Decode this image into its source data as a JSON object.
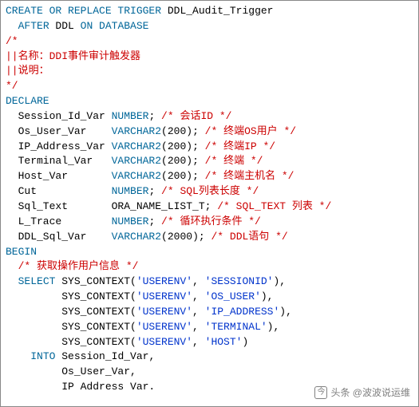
{
  "lines": [
    [
      {
        "c": "kw",
        "t": "CREATE OR REPLACE TRIGGER"
      },
      {
        "c": "ident",
        "t": " DDL_Audit_Trigger"
      }
    ],
    [
      {
        "c": "ident",
        "t": "  "
      },
      {
        "c": "kw",
        "t": "AFTER"
      },
      {
        "c": "ident",
        "t": " DDL "
      },
      {
        "c": "kw",
        "t": "ON DATABASE"
      }
    ],
    [
      {
        "c": "cm",
        "t": "/*"
      }
    ],
    [
      {
        "c": "cm",
        "t": "||名称：DDI事件审计触发器"
      }
    ],
    [
      {
        "c": "cm",
        "t": "||说明："
      }
    ],
    [
      {
        "c": "cm",
        "t": "*/"
      }
    ],
    [
      {
        "c": "kw",
        "t": "DECLARE"
      }
    ],
    [
      {
        "c": "ident",
        "t": ""
      }
    ],
    [
      {
        "c": "ident",
        "t": "  Session_Id_Var "
      },
      {
        "c": "kw",
        "t": "NUMBER"
      },
      {
        "c": "ident",
        "t": "; "
      },
      {
        "c": "cm",
        "t": "/* 会话ID */"
      }
    ],
    [
      {
        "c": "ident",
        "t": "  Os_User_Var    "
      },
      {
        "c": "kw",
        "t": "VARCHAR2"
      },
      {
        "c": "ident",
        "t": "("
      },
      {
        "c": "num",
        "t": "200"
      },
      {
        "c": "ident",
        "t": "); "
      },
      {
        "c": "cm",
        "t": "/* 终端OS用户 */"
      }
    ],
    [
      {
        "c": "ident",
        "t": "  IP_Address_Var "
      },
      {
        "c": "kw",
        "t": "VARCHAR2"
      },
      {
        "c": "ident",
        "t": "("
      },
      {
        "c": "num",
        "t": "200"
      },
      {
        "c": "ident",
        "t": "); "
      },
      {
        "c": "cm",
        "t": "/* 终端IP */"
      }
    ],
    [
      {
        "c": "ident",
        "t": "  Terminal_Var   "
      },
      {
        "c": "kw",
        "t": "VARCHAR2"
      },
      {
        "c": "ident",
        "t": "("
      },
      {
        "c": "num",
        "t": "200"
      },
      {
        "c": "ident",
        "t": "); "
      },
      {
        "c": "cm",
        "t": "/* 终端 */"
      }
    ],
    [
      {
        "c": "ident",
        "t": "  Host_Var       "
      },
      {
        "c": "kw",
        "t": "VARCHAR2"
      },
      {
        "c": "ident",
        "t": "("
      },
      {
        "c": "num",
        "t": "200"
      },
      {
        "c": "ident",
        "t": "); "
      },
      {
        "c": "cm",
        "t": "/* 终端主机名 */"
      }
    ],
    [
      {
        "c": "ident",
        "t": "  Cut            "
      },
      {
        "c": "kw",
        "t": "NUMBER"
      },
      {
        "c": "ident",
        "t": "; "
      },
      {
        "c": "cm",
        "t": "/* SQL列表长度 */"
      }
    ],
    [
      {
        "c": "ident",
        "t": "  Sql_Text       ORA_NAME_LIST_T; "
      },
      {
        "c": "cm",
        "t": "/* SQL_TEXT 列表 */"
      }
    ],
    [
      {
        "c": "ident",
        "t": "  L_Trace        "
      },
      {
        "c": "kw",
        "t": "NUMBER"
      },
      {
        "c": "ident",
        "t": "; "
      },
      {
        "c": "cm",
        "t": "/* 循环执行条件 */"
      }
    ],
    [
      {
        "c": "ident",
        "t": "  DDL_Sql_Var    "
      },
      {
        "c": "kw",
        "t": "VARCHAR2"
      },
      {
        "c": "ident",
        "t": "("
      },
      {
        "c": "num",
        "t": "2000"
      },
      {
        "c": "ident",
        "t": "); "
      },
      {
        "c": "cm",
        "t": "/* DDL语句 */"
      }
    ],
    [
      {
        "c": "ident",
        "t": ""
      }
    ],
    [
      {
        "c": "kw",
        "t": "BEGIN"
      }
    ],
    [
      {
        "c": "ident",
        "t": ""
      }
    ],
    [
      {
        "c": "ident",
        "t": "  "
      },
      {
        "c": "cm",
        "t": "/* 获取操作用户信息 */"
      }
    ],
    [
      {
        "c": "ident",
        "t": "  "
      },
      {
        "c": "kw",
        "t": "SELECT"
      },
      {
        "c": "ident",
        "t": " SYS_CONTEXT("
      },
      {
        "c": "str",
        "t": "'USERENV'"
      },
      {
        "c": "ident",
        "t": ", "
      },
      {
        "c": "str",
        "t": "'SESSIONID'"
      },
      {
        "c": "ident",
        "t": "),"
      }
    ],
    [
      {
        "c": "ident",
        "t": "         SYS_CONTEXT("
      },
      {
        "c": "str",
        "t": "'USERENV'"
      },
      {
        "c": "ident",
        "t": ", "
      },
      {
        "c": "str",
        "t": "'OS_USER'"
      },
      {
        "c": "ident",
        "t": "),"
      }
    ],
    [
      {
        "c": "ident",
        "t": "         SYS_CONTEXT("
      },
      {
        "c": "str",
        "t": "'USERENV'"
      },
      {
        "c": "ident",
        "t": ", "
      },
      {
        "c": "str",
        "t": "'IP_ADDRESS'"
      },
      {
        "c": "ident",
        "t": "),"
      }
    ],
    [
      {
        "c": "ident",
        "t": "         SYS_CONTEXT("
      },
      {
        "c": "str",
        "t": "'USERENV'"
      },
      {
        "c": "ident",
        "t": ", "
      },
      {
        "c": "str",
        "t": "'TERMINAL'"
      },
      {
        "c": "ident",
        "t": "),"
      }
    ],
    [
      {
        "c": "ident",
        "t": "         SYS_CONTEXT("
      },
      {
        "c": "str",
        "t": "'USERENV'"
      },
      {
        "c": "ident",
        "t": ", "
      },
      {
        "c": "str",
        "t": "'HOST'"
      },
      {
        "c": "ident",
        "t": ")"
      }
    ],
    [
      {
        "c": "ident",
        "t": "    "
      },
      {
        "c": "kw",
        "t": "INTO"
      },
      {
        "c": "ident",
        "t": " Session_Id_Var,"
      }
    ],
    [
      {
        "c": "ident",
        "t": "         Os_User_Var,"
      }
    ],
    [
      {
        "c": "ident",
        "t": "         IP Address Var."
      }
    ]
  ],
  "watermark": {
    "icon_glyph": "今",
    "text": "头条 @波波说运维"
  }
}
